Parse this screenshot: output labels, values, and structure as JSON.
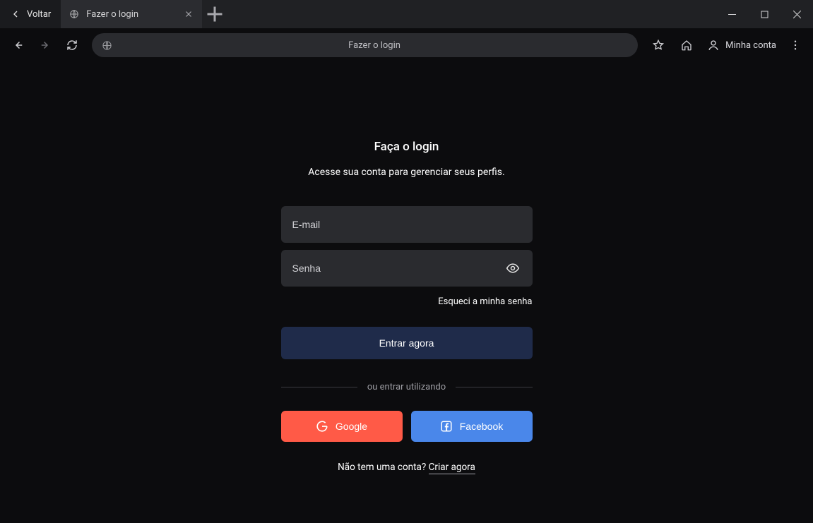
{
  "titlebar": {
    "back_label": "Voltar",
    "tab_title": "Fazer o login"
  },
  "toolbar": {
    "address_text": "Fazer o login",
    "account_label": "Minha conta"
  },
  "login": {
    "title": "Faça o login",
    "subtitle": "Acesse sua conta para gerenciar seus perfis.",
    "email_placeholder": "E-mail",
    "password_placeholder": "Senha",
    "forgot_label": "Esqueci a minha senha",
    "submit_label": "Entrar agora",
    "divider_label": "ou entrar utilizando",
    "google_label": "Google",
    "facebook_label": "Facebook",
    "signup_prefix": "Não tem uma conta? ",
    "signup_link": "Criar agora"
  }
}
